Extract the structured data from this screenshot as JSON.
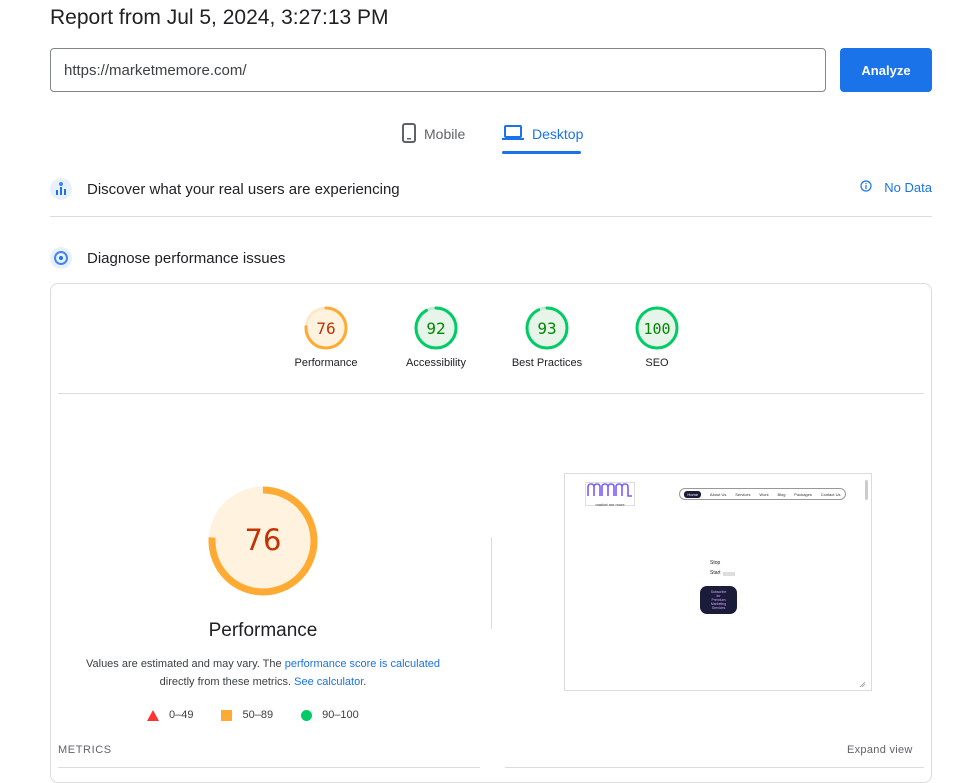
{
  "header": {
    "title": "Report from Jul 5, 2024, 3:27:13 PM"
  },
  "search": {
    "url_value": "https://marketmemore.com/",
    "analyze_label": "Analyze"
  },
  "tabs": [
    {
      "label": "Mobile",
      "icon": "phone-icon",
      "active": false
    },
    {
      "label": "Desktop",
      "icon": "laptop-icon",
      "active": true
    }
  ],
  "crux": {
    "title": "Discover what your real users are experiencing",
    "no_data_label": "No Data"
  },
  "diagnose": {
    "title": "Diagnose performance issues"
  },
  "scores": [
    {
      "label": "Performance",
      "value": "76",
      "color": "#fa3",
      "text_color": "#c33300",
      "bg": "#fff3e0"
    },
    {
      "label": "Accessibility",
      "value": "92",
      "color": "#0c6",
      "text_color": "#008800",
      "bg": "#e6f4ea"
    },
    {
      "label": "Best Practices",
      "value": "93",
      "color": "#0c6",
      "text_color": "#008800",
      "bg": "#e6f4ea"
    },
    {
      "label": "SEO",
      "value": "100",
      "color": "#0c6",
      "text_color": "#008800",
      "bg": "#e6f4ea"
    }
  ],
  "performance": {
    "score": "76",
    "score_fraction": 0.76,
    "title": "Performance",
    "desc_prefix": "Values are estimated and may vary. The ",
    "desc_link1": "performance score is calculated",
    "desc_middle": "directly from these metrics. ",
    "desc_link2": "See calculator",
    "desc_suffix": "."
  },
  "legend": [
    {
      "label": "0–49",
      "shape": "triangle",
      "color": "#f33"
    },
    {
      "label": "50–89",
      "shape": "square",
      "color": "#fa3"
    },
    {
      "label": "90–100",
      "shape": "circle",
      "color": "#0c6"
    }
  ],
  "screenshot_page": {
    "logo_text": "market me more",
    "nav": [
      "Home",
      "About Us",
      "Services",
      "Work",
      "Blog",
      "Packages",
      "Contact Us"
    ],
    "hero_lines": [
      "Stop",
      "Start"
    ],
    "cta_lines": [
      "Subscribe",
      "for",
      "Premium",
      "Marketing",
      "Services"
    ]
  },
  "metrics": {
    "label": "METRICS",
    "expand_label": "Expand view"
  },
  "colors": {
    "accent": "#1a73e8"
  }
}
